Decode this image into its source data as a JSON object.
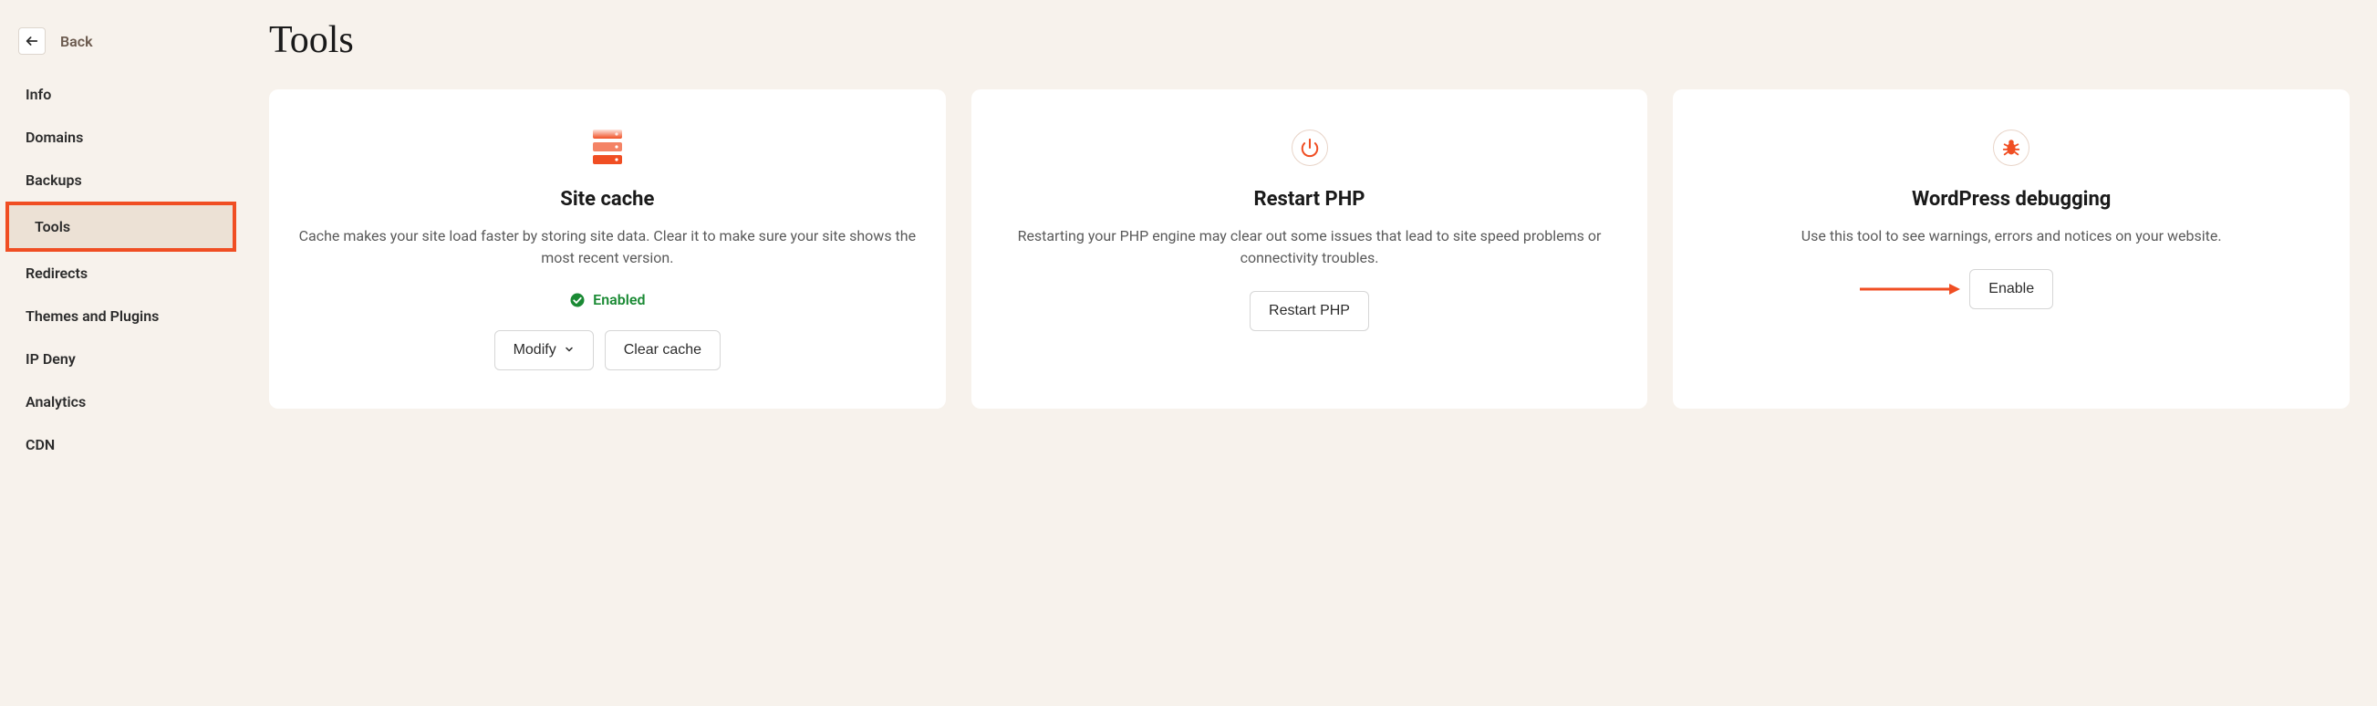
{
  "back": {
    "label": "Back"
  },
  "nav": {
    "items": [
      {
        "label": "Info"
      },
      {
        "label": "Domains"
      },
      {
        "label": "Backups"
      },
      {
        "label": "Tools"
      },
      {
        "label": "Redirects"
      },
      {
        "label": "Themes and Plugins"
      },
      {
        "label": "IP Deny"
      },
      {
        "label": "Analytics"
      },
      {
        "label": "CDN"
      }
    ],
    "active_index": 3
  },
  "page": {
    "title": "Tools"
  },
  "cards": {
    "site_cache": {
      "title": "Site cache",
      "desc": "Cache makes your site load faster by storing site data. Clear it to make sure your site shows the most recent version.",
      "status": "Enabled",
      "modify_label": "Modify",
      "clear_label": "Clear cache"
    },
    "restart_php": {
      "title": "Restart PHP",
      "desc": "Restarting your PHP engine may clear out some issues that lead to site speed problems or connectivity troubles.",
      "button_label": "Restart PHP"
    },
    "wp_debugging": {
      "title": "WordPress debugging",
      "desc": "Use this tool to see warnings, errors and notices on your website.",
      "button_label": "Enable"
    }
  }
}
